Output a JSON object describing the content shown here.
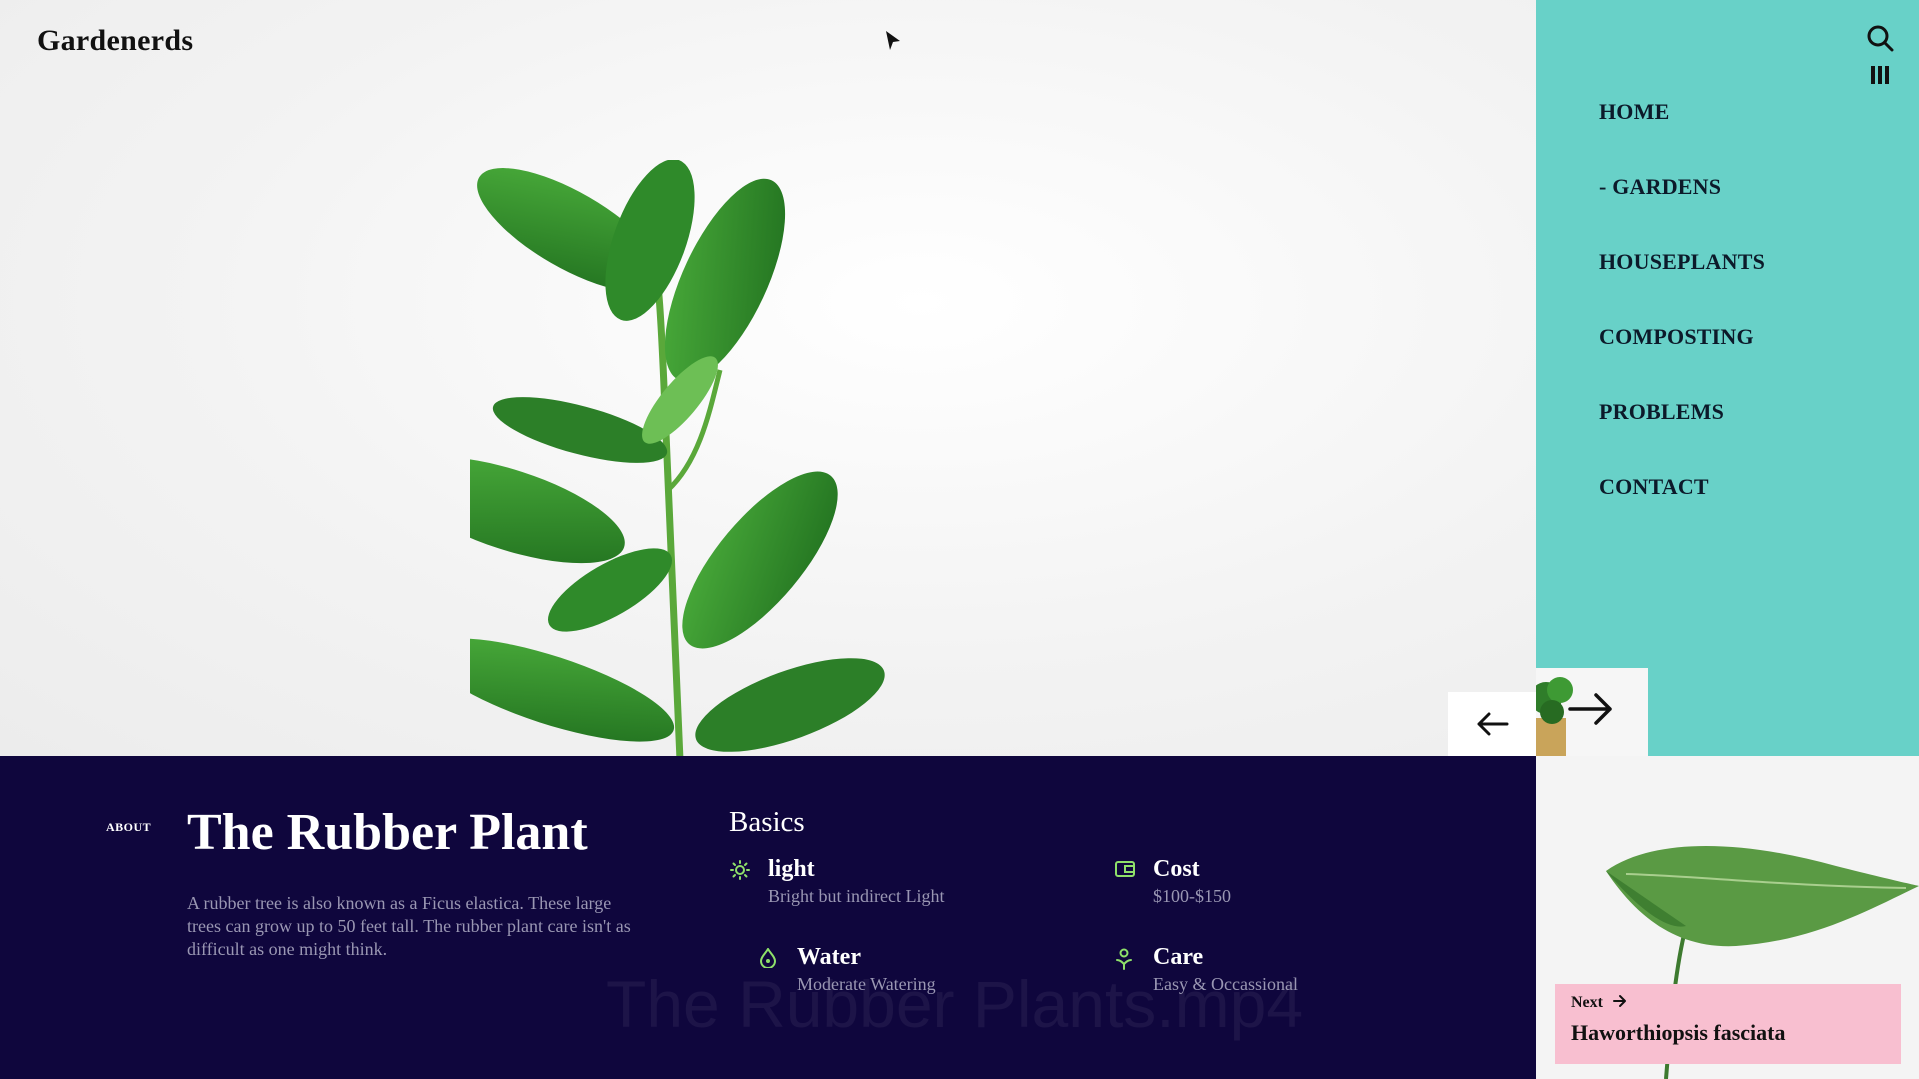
{
  "brand": {
    "name": "Gardenerds"
  },
  "nav": {
    "items": [
      {
        "label": "HOME"
      },
      {
        "label": "- GARDENS"
      },
      {
        "label": "HOUSEPLANTS"
      },
      {
        "label": "COMPOSTING"
      },
      {
        "label": "PROBLEMS"
      },
      {
        "label": "CONTACT"
      }
    ]
  },
  "about": {
    "section_label": "ABOUT",
    "title": "The Rubber Plant",
    "description": "A rubber tree is also known as a Ficus elastica. These large trees can grow up to 50 feet tall. The rubber plant care isn't as difficult as one might think."
  },
  "basics": {
    "title": "Basics",
    "light": {
      "label": "light",
      "value": "Bright but indirect Light"
    },
    "cost": {
      "label": "Cost",
      "value": "$100-$150"
    },
    "water": {
      "label": "Water",
      "value": "Moderate Watering"
    },
    "care": {
      "label": "Care",
      "value": "Easy & Occassional"
    }
  },
  "next": {
    "label": "Next",
    "name": "Haworthiopsis fasciata"
  },
  "watermark": "The Rubber Plants.mp4",
  "colors": {
    "sidebar": "#68d1c8",
    "info_panel": "#0f063d",
    "next_card": "#f8bfd0",
    "icon_accent": "#8ee06a"
  },
  "icons": {
    "search": "search-icon",
    "menu": "menu-icon",
    "prev": "arrow-left-icon",
    "next": "arrow-right-icon",
    "light": "sun-icon",
    "cost": "wallet-icon",
    "water": "water-drop-icon",
    "care": "care-hand-icon"
  }
}
